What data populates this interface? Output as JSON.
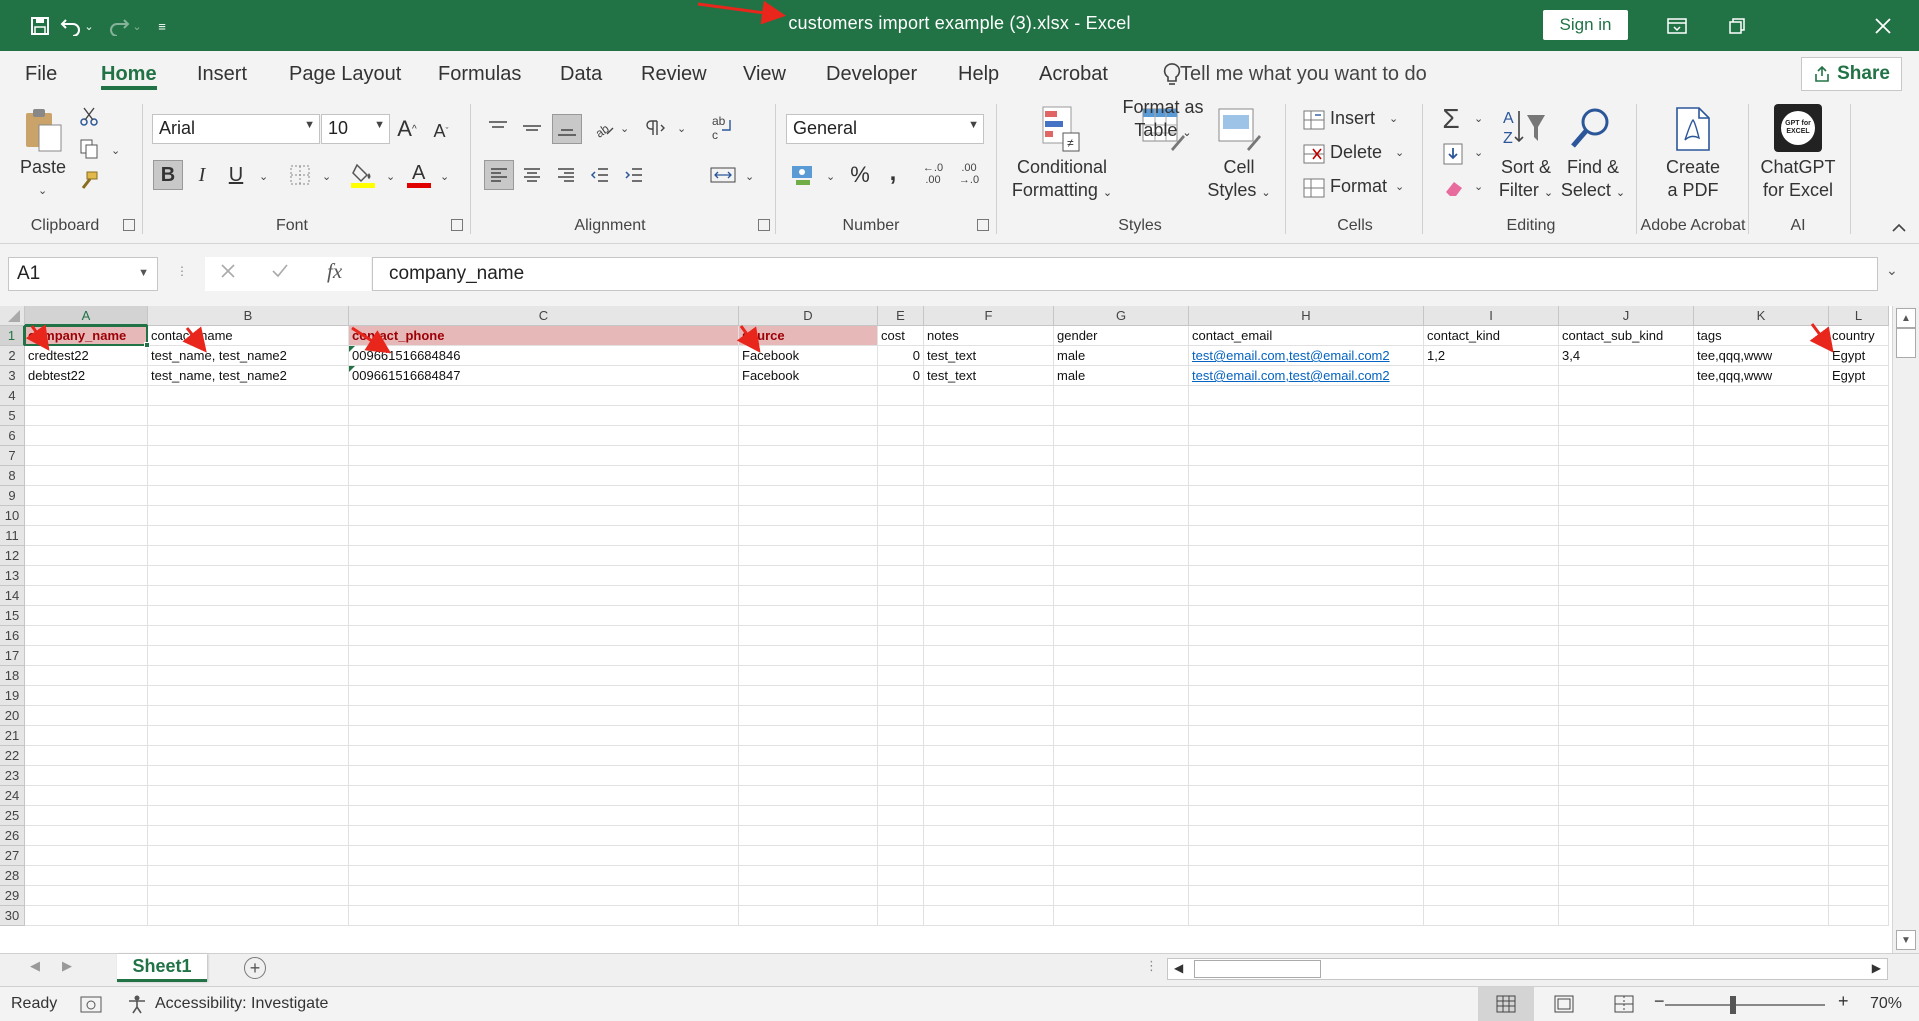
{
  "titlebar": {
    "title": "customers import example (3).xlsx  -  Excel",
    "sign_in": "Sign in"
  },
  "menu": {
    "tabs": [
      "File",
      "Home",
      "Insert",
      "Page Layout",
      "Formulas",
      "Data",
      "Review",
      "View",
      "Developer",
      "Help",
      "Acrobat"
    ],
    "tell_me": "Tell me what you want to do",
    "share": "Share"
  },
  "ribbon": {
    "clipboard": {
      "paste": "Paste",
      "label": "Clipboard"
    },
    "font": {
      "name": "Arial",
      "size": "10",
      "label": "Font"
    },
    "alignment": {
      "label": "Alignment"
    },
    "number": {
      "format": "General",
      "label": "Number",
      "percent": "%",
      "comma": ",",
      "inc_dec": "←.0 .00",
      "dec_dec": ".00 →.0"
    },
    "styles": {
      "conditional_1": "Conditional",
      "conditional_2": "Formatting",
      "format_table_1": "Format as",
      "format_table_2": "Table",
      "cell_styles_1": "Cell",
      "cell_styles_2": "Styles",
      "label": "Styles"
    },
    "cells": {
      "insert": "Insert",
      "delete": "Delete",
      "format": "Format",
      "label": "Cells"
    },
    "editing": {
      "sort_1": "Sort &",
      "sort_2": "Filter",
      "find_1": "Find &",
      "find_2": "Select",
      "label": "Editing"
    },
    "acrobat": {
      "create_1": "Create",
      "create_2": "a PDF",
      "label": "Adobe Acrobat"
    },
    "ai": {
      "chatgpt_1": "ChatGPT",
      "chatgpt_2": "for Excel",
      "logo_text": "GPT for EXCEL",
      "label": "AI"
    }
  },
  "formula_bar": {
    "name_box": "A1",
    "fx": "fx",
    "content": "company_name"
  },
  "grid": {
    "columns": [
      "A",
      "B",
      "C",
      "D",
      "E",
      "F",
      "G",
      "H",
      "I",
      "J",
      "K",
      "L"
    ],
    "row_numbers": [
      "1",
      "2",
      "3",
      "4",
      "5",
      "6",
      "7",
      "8",
      "9",
      "10",
      "11",
      "12",
      "13",
      "14",
      "15",
      "16",
      "17",
      "18",
      "19",
      "20",
      "21",
      "22",
      "23",
      "24",
      "25",
      "26",
      "27",
      "28",
      "29",
      "30"
    ],
    "headers": [
      "company_name",
      "contact_name",
      "contact_phone",
      "source",
      "cost",
      "notes",
      "gender",
      "contact_email",
      "contact_kind",
      "contact_sub_kind",
      "tags",
      "country"
    ],
    "rows": [
      [
        "credtest22",
        "test_name, test_name2",
        "009661516684846",
        "Facebook",
        "0",
        "test_text",
        "male",
        "test@email.com,test@email.com2",
        "1,2",
        "3,4",
        "tee,qqq,www",
        "Egypt"
      ],
      [
        "debtest22",
        "test_name, test_name2",
        "009661516684847",
        "Facebook",
        "0",
        "test_text",
        "male",
        "test@email.com,test@email.com2",
        "",
        "",
        "tee,qqq,www",
        "Egypt"
      ]
    ]
  },
  "sheets": {
    "tabs": [
      "Sheet1"
    ],
    "add": "+"
  },
  "status": {
    "ready": "Ready",
    "accessibility": "Accessibility: Investigate",
    "zoom": "70%",
    "zoom_minus": "−",
    "zoom_plus": "+"
  },
  "colors": {
    "brand": "#217346",
    "header_fill": "#e6b8b7",
    "header_text": "#9c0006",
    "link": "#0563c1",
    "arrow": "#e8261c"
  }
}
